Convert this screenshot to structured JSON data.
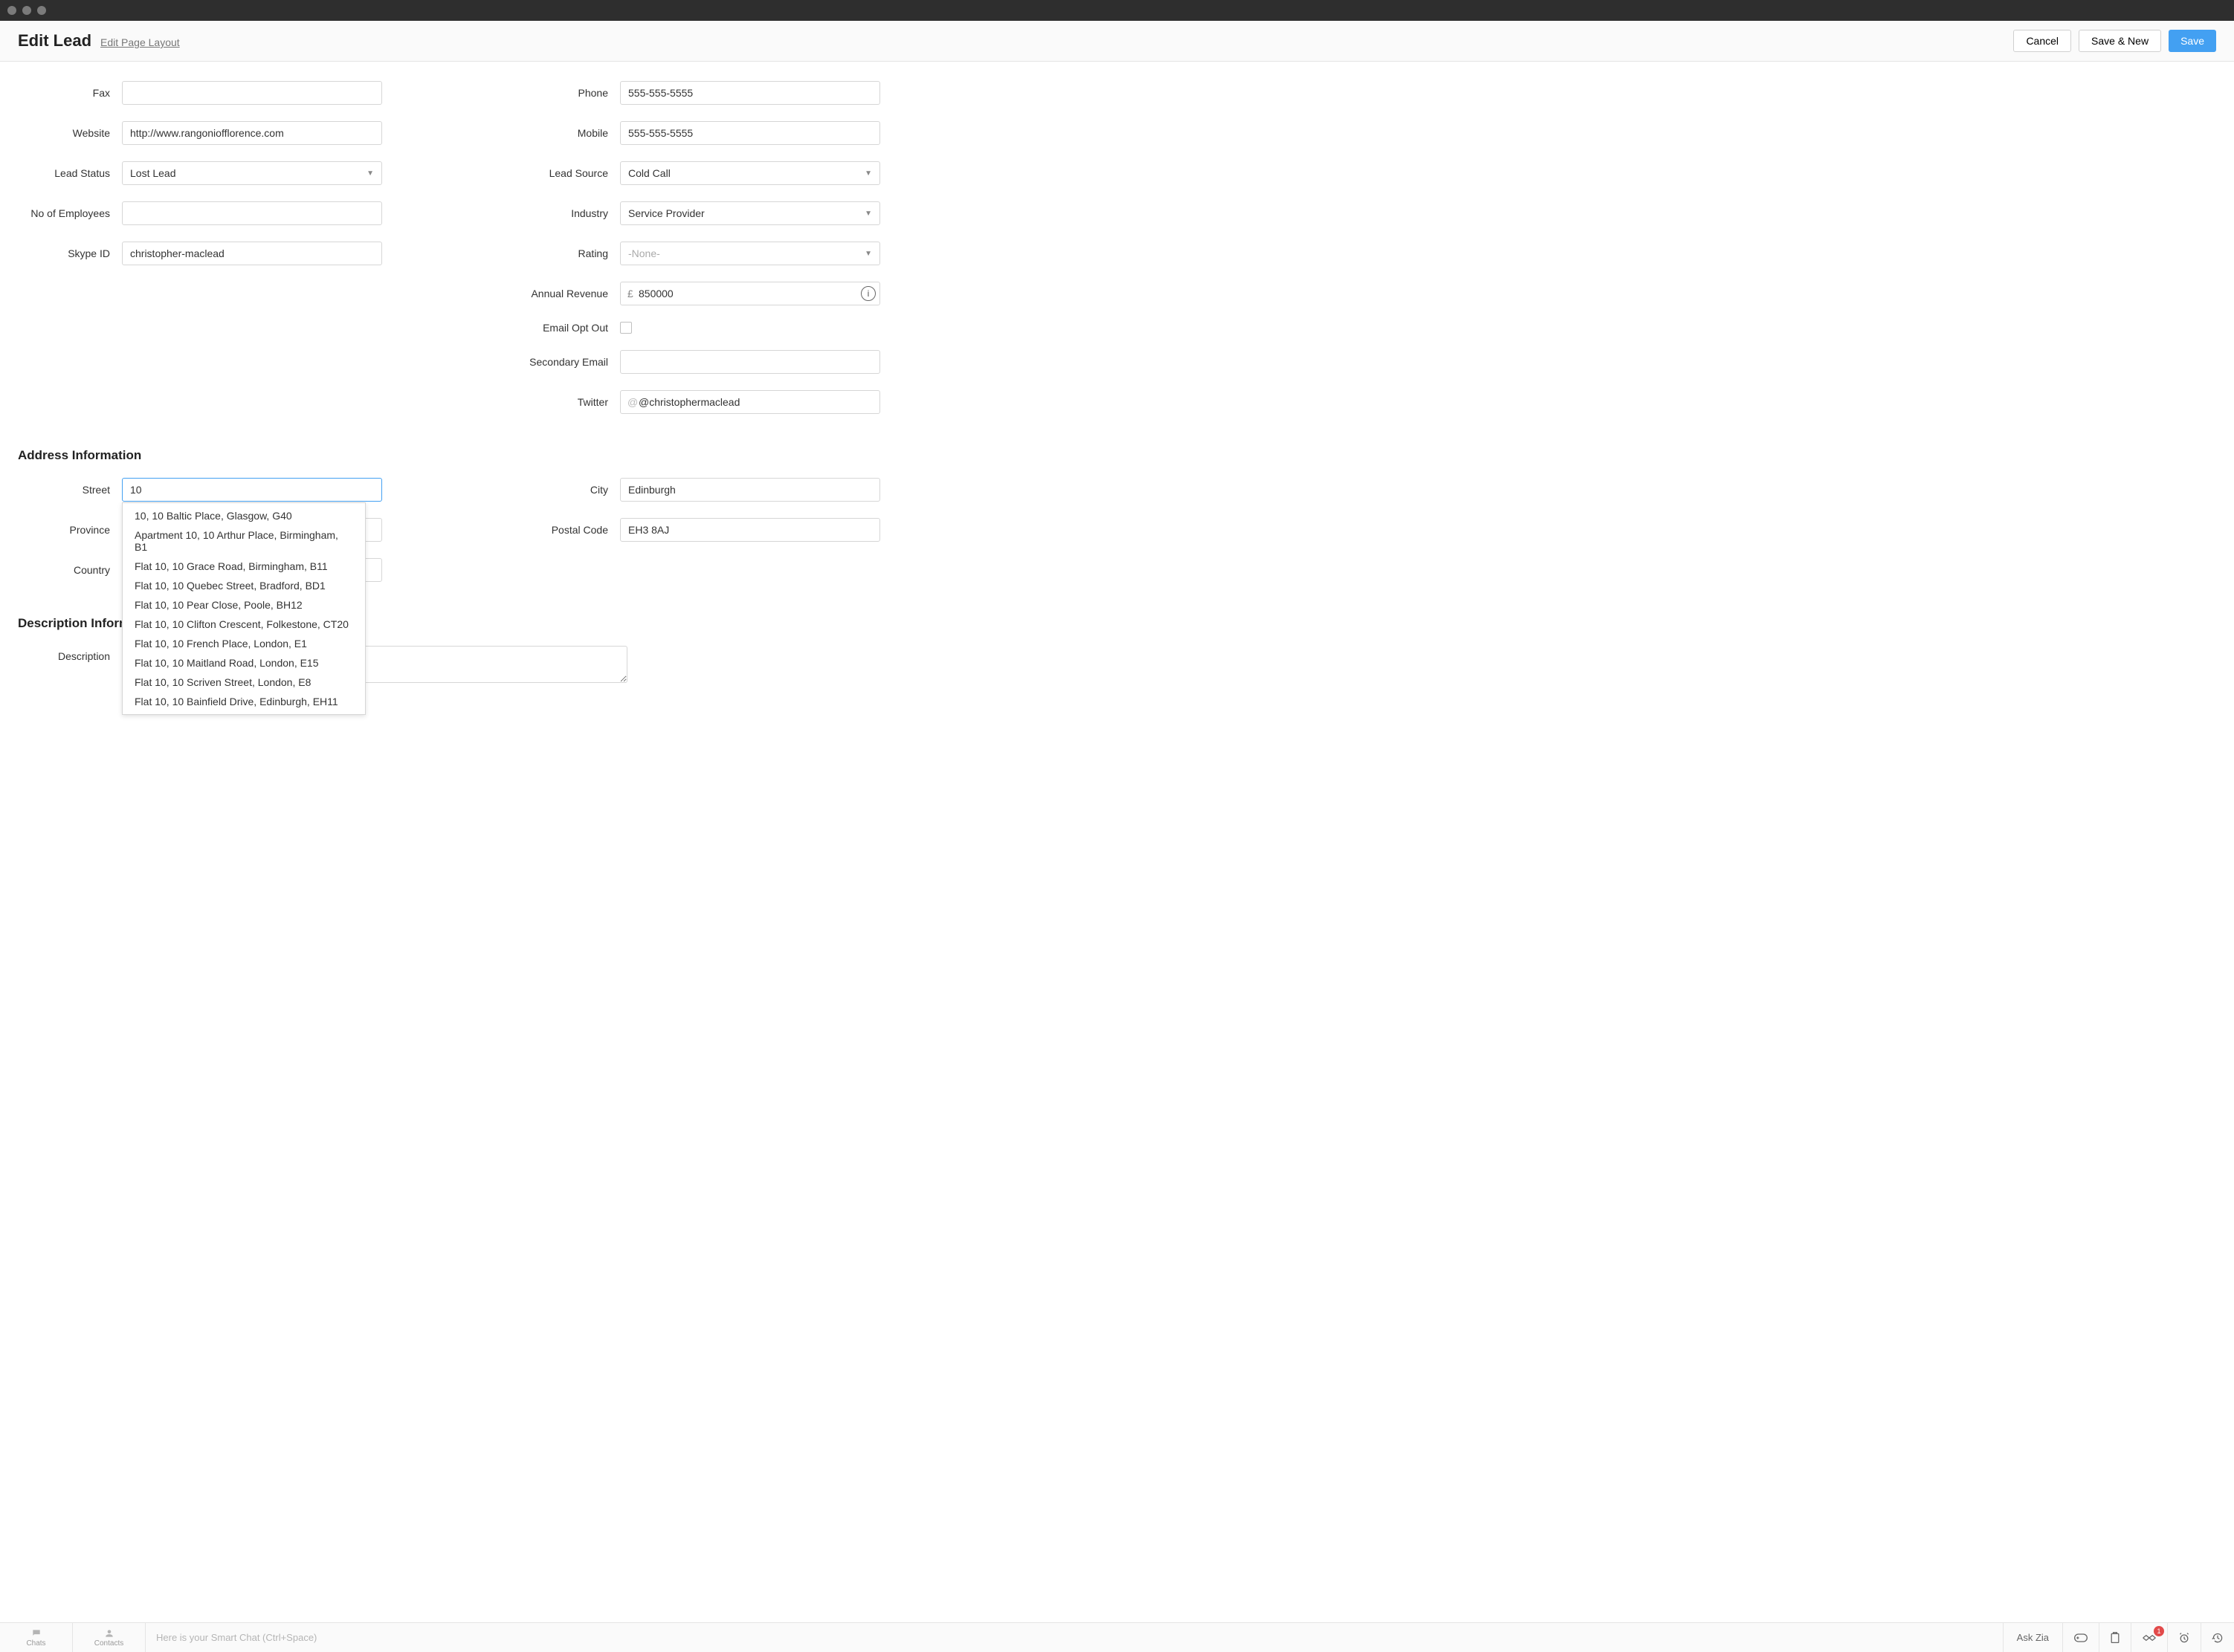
{
  "header": {
    "title": "Edit Lead",
    "edit_layout": "Edit Page Layout",
    "cancel": "Cancel",
    "save_new": "Save & New",
    "save": "Save"
  },
  "left": {
    "fax_label": "Fax",
    "fax_value": "",
    "website_label": "Website",
    "website_value": "http://www.rangoniofflorence.com",
    "leadstatus_label": "Lead Status",
    "leadstatus_value": "Lost Lead",
    "employees_label": "No of Employees",
    "employees_value": "",
    "skype_label": "Skype ID",
    "skype_value": "christopher-maclead"
  },
  "right": {
    "phone_label": "Phone",
    "phone_value": "555-555-5555",
    "mobile_label": "Mobile",
    "mobile_value": "555-555-5555",
    "leadsource_label": "Lead Source",
    "leadsource_value": "Cold Call",
    "industry_label": "Industry",
    "industry_value": "Service Provider",
    "rating_label": "Rating",
    "rating_value": "-None-",
    "revenue_label": "Annual Revenue",
    "revenue_currency": "£",
    "revenue_value": "850000",
    "optout_label": "Email Opt Out",
    "secondary_label": "Secondary Email",
    "secondary_value": "",
    "twitter_label": "Twitter",
    "twitter_at": "@",
    "twitter_value": "@christophermaclead"
  },
  "address": {
    "section": "Address Information",
    "street_label": "Street",
    "street_value": "10 ",
    "city_label": "City",
    "city_value": "Edinburgh",
    "province_label": "Province",
    "postal_label": "Postal Code",
    "postal_value": "EH3 8AJ",
    "country_label": "Country",
    "suggestions": [
      "10, 10 Baltic Place, Glasgow, G40",
      "Apartment 10, 10 Arthur Place, Birmingham, B1",
      "Flat 10, 10 Grace Road, Birmingham, B11",
      "Flat 10, 10 Quebec Street, Bradford, BD1",
      "Flat 10, 10 Pear Close, Poole, BH12",
      "Flat 10, 10 Clifton Crescent, Folkestone, CT20",
      "Flat 10, 10 French Place, London, E1",
      "Flat 10, 10 Maitland Road, London, E15",
      "Flat 10, 10 Scriven Street, London, E8",
      "Flat 10, 10 Bainfield Drive, Edinburgh, EH11"
    ]
  },
  "description": {
    "section": "Description Information",
    "label": "Description",
    "value": ""
  },
  "bottombar": {
    "chats": "Chats",
    "contacts": "Contacts",
    "smartchat_placeholder": "Here is your Smart Chat (Ctrl+Space)",
    "askzia": "Ask Zia",
    "badge": "1"
  }
}
